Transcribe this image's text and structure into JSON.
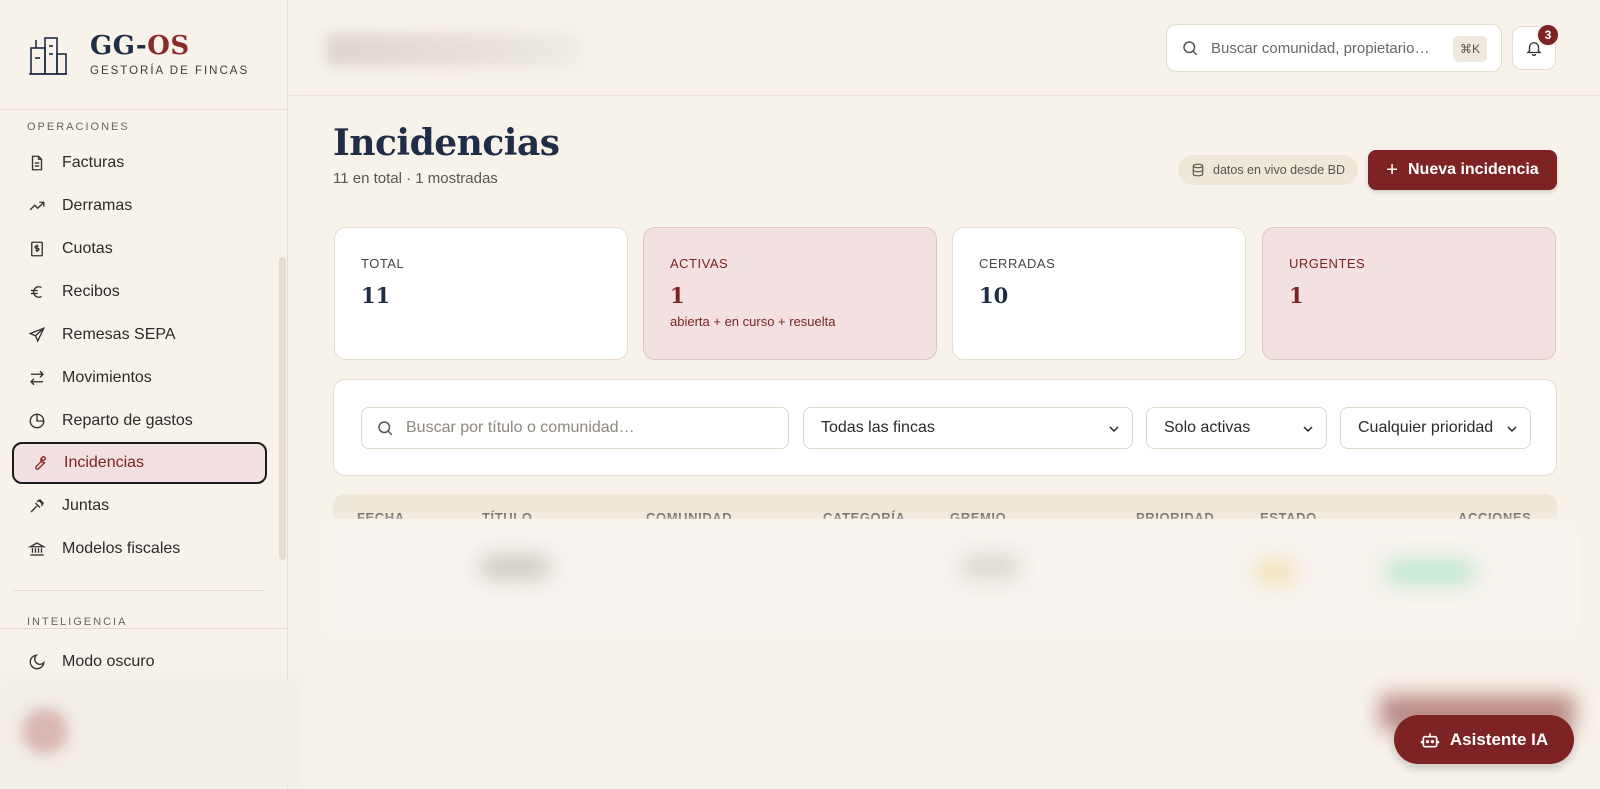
{
  "brand": {
    "name_part1": "GG-",
    "name_part2": "OS",
    "subtitle": "GESTORÍA DE FINCAS"
  },
  "sidebar": {
    "section_operaciones": "OPERACIONES",
    "items": [
      {
        "label": "Facturas",
        "icon": "invoice-icon"
      },
      {
        "label": "Derramas",
        "icon": "trending-up-icon"
      },
      {
        "label": "Cuotas",
        "icon": "receipt-dollar-icon"
      },
      {
        "label": "Recibos",
        "icon": "euro-icon"
      },
      {
        "label": "Remesas SEPA",
        "icon": "send-icon"
      },
      {
        "label": "Movimientos",
        "icon": "arrows-swap-icon"
      },
      {
        "label": "Reparto de gastos",
        "icon": "pie-chart-icon"
      },
      {
        "label": "Incidencias",
        "icon": "wrench-icon",
        "active": true
      },
      {
        "label": "Juntas",
        "icon": "gavel-icon"
      },
      {
        "label": "Modelos fiscales",
        "icon": "bank-icon"
      }
    ],
    "section_inteligencia": "INTELIGENCIA",
    "dark_mode": "Modo oscuro"
  },
  "topbar": {
    "search_placeholder": "Buscar comunidad, propietario…",
    "shortcut": "⌘K",
    "notification_count": "3"
  },
  "header": {
    "title": "Incidencias",
    "subtitle": "11 en total · 1 mostradas",
    "live_data": "datos en vivo desde BD",
    "new_button": "Nueva incidencia"
  },
  "stats": [
    {
      "label": "TOTAL",
      "value": "11",
      "note": ""
    },
    {
      "label": "ACTIVAS",
      "value": "1",
      "note": "abierta + en curso + resuelta"
    },
    {
      "label": "CERRADAS",
      "value": "10",
      "note": ""
    },
    {
      "label": "URGENTES",
      "value": "1",
      "note": ""
    }
  ],
  "filters": {
    "search_placeholder": "Buscar por título o comunidad…",
    "fincas": "Todas las fincas",
    "estado": "Solo activas",
    "prioridad": "Cualquier prioridad"
  },
  "table": {
    "columns": [
      "FECHA",
      "TÍTULO",
      "COMUNIDAD",
      "CATEGORÍA",
      "GREMIO",
      "PRIORIDAD",
      "ESTADO",
      "ACCIONES"
    ]
  },
  "assistant": {
    "label": "Asistente IA"
  },
  "colors": {
    "accent": "#7d2323",
    "navy": "#1f2d46",
    "background": "#f7f2ea"
  }
}
